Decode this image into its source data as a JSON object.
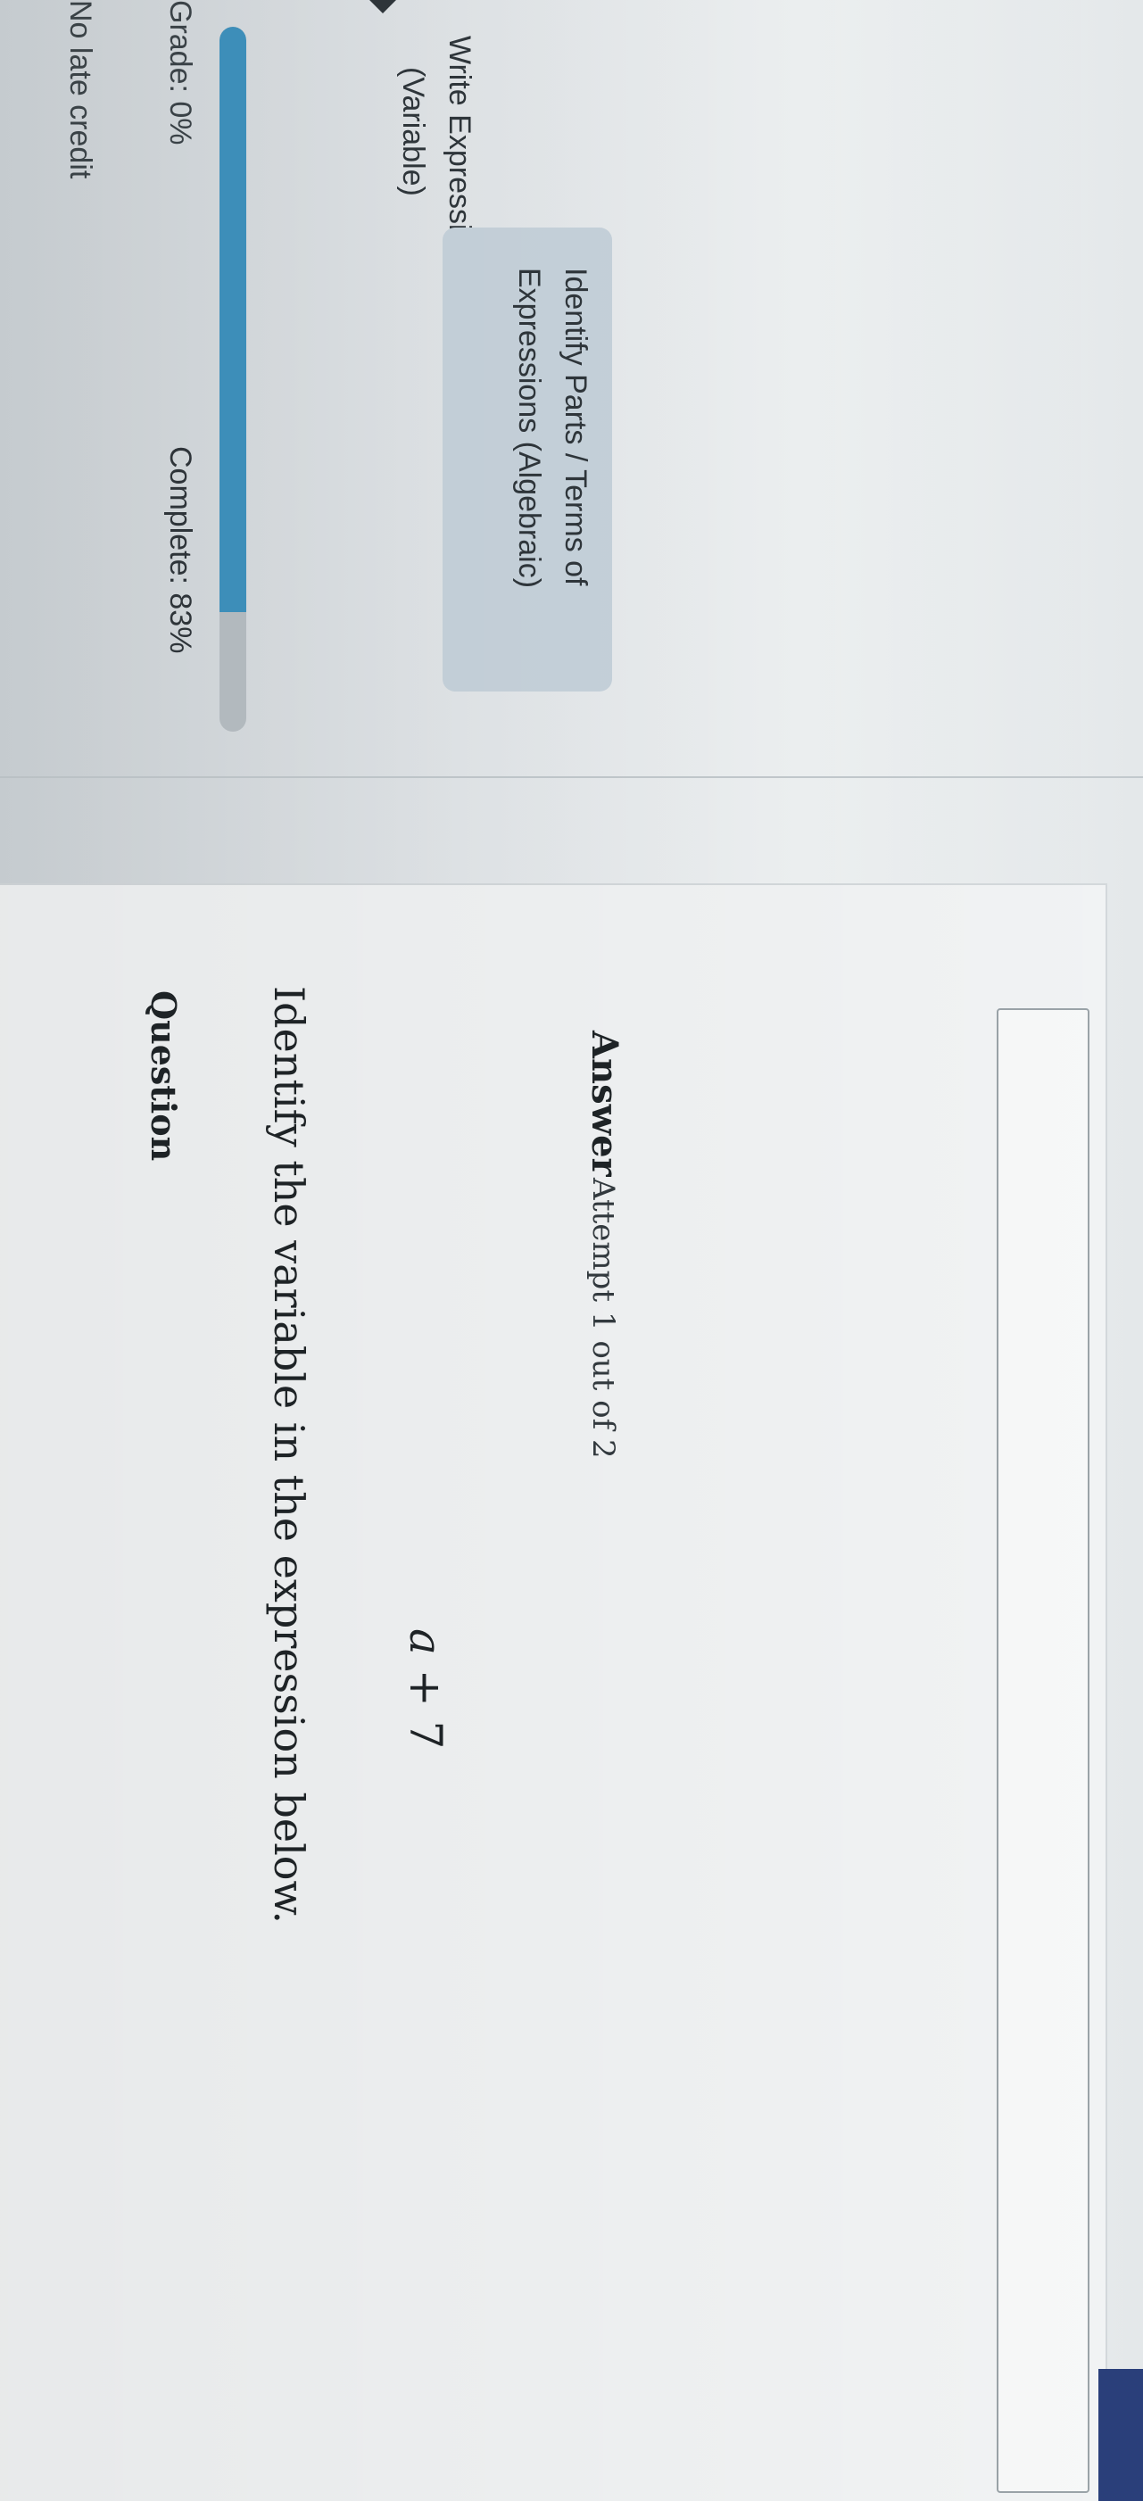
{
  "sidebar": {
    "late_credit": "No late credit",
    "grade": "Grade: 0%",
    "complete": "Complete: 83%",
    "progress_fraction": 0.83,
    "items": [
      {
        "line1": "Write Expressions from Words",
        "line2": "(Variable)",
        "active": false
      },
      {
        "line1": "Identify Parts / Terms of",
        "line2": "Expressions (Algebraic)",
        "active": true
      }
    ]
  },
  "question": {
    "heading": "Question",
    "prompt": "Identify the variable in the expression below.",
    "expression_var": "a",
    "expression_rest": " + 7"
  },
  "answer": {
    "label": "Answer",
    "attempt": "Attempt 1 out of 2",
    "input_value": ""
  },
  "colors": {
    "accent": "#3f93bf",
    "active_item_bg": "#c7d3dc",
    "edge_bar": "#2a3f7a"
  }
}
